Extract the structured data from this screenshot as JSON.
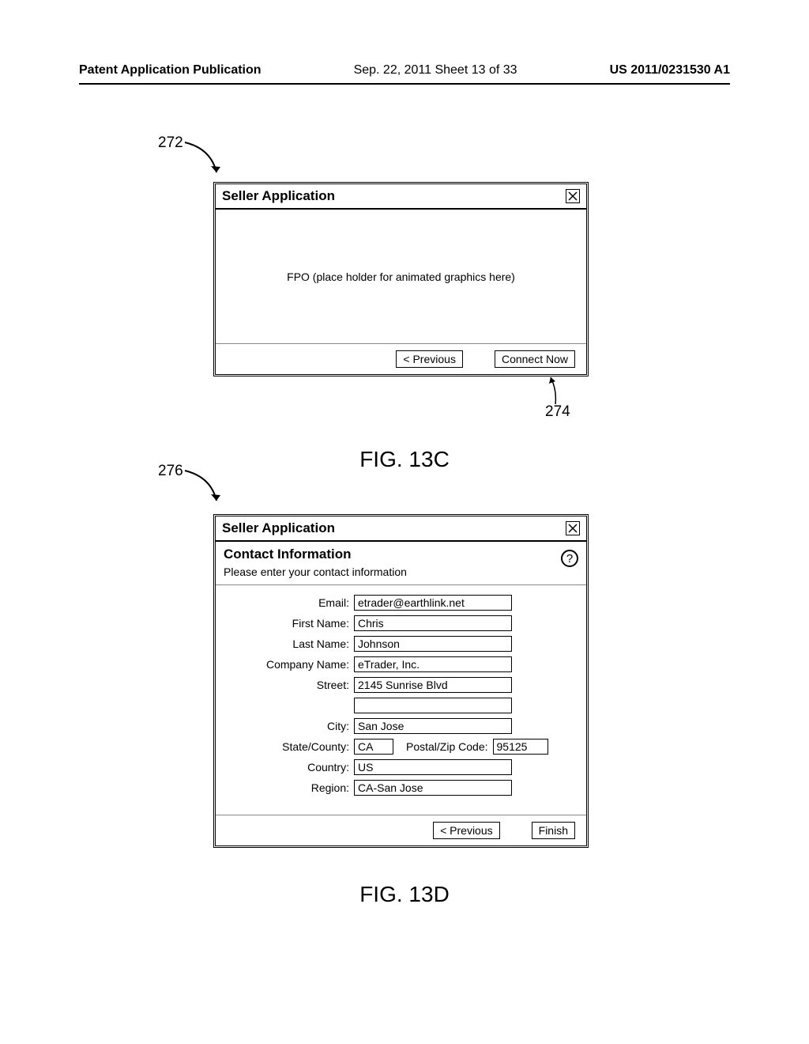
{
  "header": {
    "left": "Patent Application Publication",
    "center": "Sep. 22, 2011  Sheet 13 of 33",
    "right": "US 2011/0231530 A1"
  },
  "ref_labels": {
    "r272": "272",
    "r274": "274",
    "r276": "276"
  },
  "fig_captions": {
    "c": "FIG. 13C",
    "d": "FIG. 13D"
  },
  "window_c": {
    "title": "Seller Application",
    "fpo": "FPO (place holder for animated graphics here)",
    "prev": "< Previous",
    "connect": "Connect Now"
  },
  "window_d": {
    "title": "Seller Application",
    "section_title": "Contact Information",
    "section_sub": "Please enter your contact information",
    "labels": {
      "email": "Email:",
      "first": "First Name:",
      "last": "Last Name:",
      "company": "Company Name:",
      "street": "Street:",
      "city": "City:",
      "state": "State/County:",
      "zip": "Postal/Zip Code:",
      "country": "Country:",
      "region": "Region:"
    },
    "values": {
      "email": "etrader@earthlink.net",
      "first": "Chris",
      "last": "Johnson",
      "company": "eTrader, Inc.",
      "street": "2145 Sunrise Blvd",
      "street2": "",
      "city": "San Jose",
      "state": "CA",
      "zip": "95125",
      "country": "US",
      "region": "CA-San Jose"
    },
    "prev": "< Previous",
    "finish": "Finish"
  }
}
